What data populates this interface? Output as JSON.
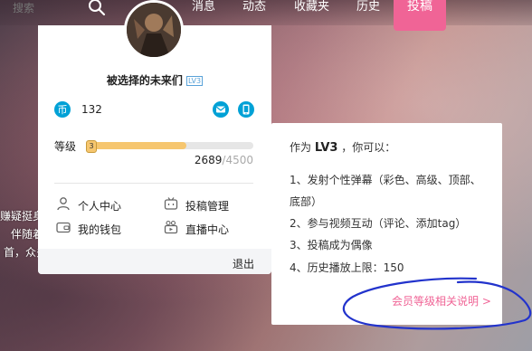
{
  "search": {
    "placeholder": "搜索",
    "icon": "search-icon"
  },
  "nav": {
    "items": [
      "消息",
      "动态",
      "收藏夹",
      "历史"
    ],
    "upload_label": "投稿",
    "upload_color": "#f06496"
  },
  "background_text": [
    "赚疑挺身",
    "伴随着",
    "首，众多"
  ],
  "user_card": {
    "username": "被选择的未来们",
    "level_badge": "LV3",
    "coins": "132",
    "level_label": "等级",
    "level_marker": "3",
    "exp_current": "2689",
    "exp_max": "/4500",
    "exp_progress": 0.5976,
    "menu": {
      "personal_center": "个人中心",
      "upload_manage": "投稿管理",
      "wallet": "我的钱包",
      "live_center": "直播中心"
    },
    "logout": "退出"
  },
  "tooltip": {
    "title_prefix": "作为",
    "title_level": "LV3",
    "title_suffix": "，你可以：",
    "lines": [
      "1、发射个性弹幕（彩色、高级、顶部、",
      "底部）",
      "2、参与视频互动（评论、添加tag）",
      "3、投稿成为偶像",
      "4、历史播放上限：150"
    ],
    "link": "会员等级相关说明 >"
  },
  "colors": {
    "accent": "#f06496",
    "coin": "#00a1d6",
    "exp_bar": "#f6c66f",
    "annotation": "#2233cc"
  }
}
